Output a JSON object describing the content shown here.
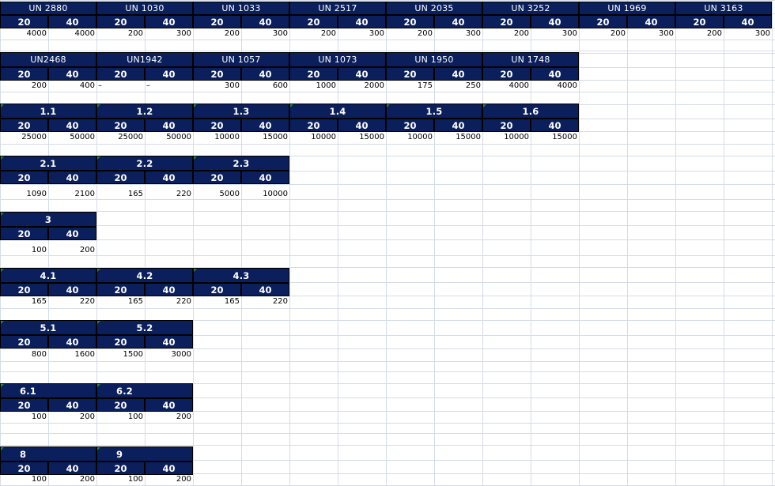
{
  "sheet": {
    "blocks": [
      {
        "groups": [
          {
            "title": "UN 2880",
            "c20": "20",
            "c40": "40",
            "v20": "4000",
            "v40": "4000"
          },
          {
            "title": "UN 1030",
            "c20": "20",
            "c40": "40",
            "v20": "200",
            "v40": "300"
          },
          {
            "title": "UN 1033",
            "c20": "20",
            "c40": "40",
            "v20": "200",
            "v40": "300"
          },
          {
            "title": "UN 2517",
            "c20": "20",
            "c40": "40",
            "v20": "200",
            "v40": "300"
          },
          {
            "title": "UN 2035",
            "c20": "20",
            "c40": "40",
            "v20": "200",
            "v40": "300"
          },
          {
            "title": "UN 3252",
            "c20": "20",
            "c40": "40",
            "v20": "200",
            "v40": "300"
          },
          {
            "title": "UN 1969",
            "c20": "20",
            "c40": "40",
            "v20": "200",
            "v40": "300"
          },
          {
            "title": "UN 3163",
            "c20": "20",
            "c40": "40",
            "v20": "200",
            "v40": "300"
          }
        ]
      },
      {
        "groups": [
          {
            "title": "UN2468",
            "c20": "20",
            "c40": "40",
            "v20": "200",
            "v40": "400"
          },
          {
            "title": "UN1942",
            "c20": "20",
            "c40": "40",
            "v20": "–",
            "v40": "–"
          },
          {
            "title": "UN 1057",
            "c20": "20",
            "c40": "40",
            "v20": "300",
            "v40": "600"
          },
          {
            "title": "UN 1073",
            "c20": "20",
            "c40": "40",
            "v20": "1000",
            "v40": "2000"
          },
          {
            "title": "UN 1950",
            "c20": "20",
            "c40": "40",
            "v20": "175",
            "v40": "250"
          },
          {
            "title": "UN 1748",
            "c20": "20",
            "c40": "40",
            "v20": "4000",
            "v40": "4000"
          }
        ]
      },
      {
        "groups": [
          {
            "title": "1.1",
            "c20": "20",
            "c40": "40",
            "v20": "25000",
            "v40": "50000"
          },
          {
            "title": "1.2",
            "c20": "20",
            "c40": "40",
            "v20": "25000",
            "v40": "50000"
          },
          {
            "title": "1.3",
            "c20": "20",
            "c40": "40",
            "v20": "10000",
            "v40": "15000"
          },
          {
            "title": "1.4",
            "c20": "20",
            "c40": "40",
            "v20": "10000",
            "v40": "15000"
          },
          {
            "title": "1.5",
            "c20": "20",
            "c40": "40",
            "v20": "10000",
            "v40": "15000"
          },
          {
            "title": "1.6",
            "c20": "20",
            "c40": "40",
            "v20": "10000",
            "v40": "15000"
          }
        ]
      },
      {
        "groups": [
          {
            "title": "2.1",
            "c20": "20",
            "c40": "40",
            "v20": "1090",
            "v40": "2100"
          },
          {
            "title": "2.2",
            "c20": "20",
            "c40": "40",
            "v20": "165",
            "v40": "220"
          },
          {
            "title": "2.3",
            "c20": "20",
            "c40": "40",
            "v20": "5000",
            "v40": "10000"
          }
        ]
      },
      {
        "groups": [
          {
            "title": "3",
            "c20": "20",
            "c40": "40",
            "v20": "100",
            "v40": "200"
          }
        ]
      },
      {
        "groups": [
          {
            "title": "4.1",
            "c20": "20",
            "c40": "40",
            "v20": "165",
            "v40": "220"
          },
          {
            "title": "4.2",
            "c20": "20",
            "c40": "40",
            "v20": "165",
            "v40": "220"
          },
          {
            "title": "4.3",
            "c20": "20",
            "c40": "40",
            "v20": "165",
            "v40": "220"
          }
        ]
      },
      {
        "groups": [
          {
            "title": "5.1",
            "c20": "20",
            "c40": "40",
            "v20": "800",
            "v40": "1600"
          },
          {
            "title": "5.2",
            "c20": "20",
            "c40": "40",
            "v20": "1500",
            "v40": "3000"
          }
        ]
      },
      {
        "groups": [
          {
            "title": "6.1",
            "c20": "20",
            "c40": "40",
            "v20": "100",
            "v40": "200"
          },
          {
            "title": "6.2",
            "c20": "20",
            "c40": "40",
            "v20": "100",
            "v40": "200"
          }
        ]
      },
      {
        "groups": [
          {
            "title": "8",
            "c20": "20",
            "c40": "40",
            "v20": "100",
            "v40": "200"
          },
          {
            "title": "9",
            "c20": "20",
            "c40": "40",
            "v20": "100",
            "v40": "200"
          }
        ]
      }
    ]
  }
}
